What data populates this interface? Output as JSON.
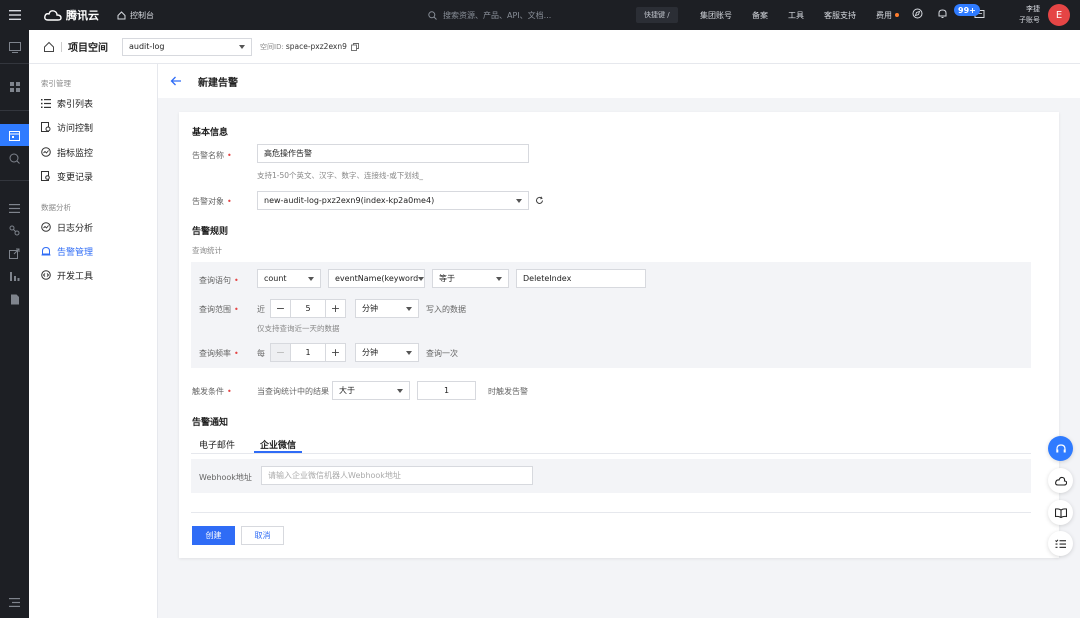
{
  "topbar": {
    "brand": "腾讯云",
    "console": "控制台",
    "search_placeholder": "搜索资源、产品、API、文档...",
    "shortcut": "快捷键 /",
    "links": [
      "集团账号",
      "备案",
      "工具",
      "客服支持",
      "费用"
    ],
    "badge": "99+",
    "user_name": "李捷",
    "user_role": "子账号",
    "avatar": "E",
    "accent": "#2f7bff"
  },
  "subheader": {
    "title": "项目空间",
    "project_select": "audit-log",
    "space_label": "空间ID:",
    "space_id": "space-pxz2exn9"
  },
  "leftnav": {
    "group1": "索引管理",
    "items1": [
      "索引列表",
      "访问控制",
      "指标监控",
      "变更记录"
    ],
    "group2": "数据分析",
    "items2": [
      "日志分析",
      "告警管理",
      "开发工具"
    ],
    "active": "告警管理"
  },
  "page": {
    "title": "新建告警"
  },
  "form": {
    "basic_title": "基本信息",
    "name_label": "告警名称",
    "name_value": "高危操作告警",
    "name_hint": "支持1-50个英文、汉字、数字、连接线-或下划线_",
    "target_label": "告警对象",
    "target_value": "new-audit-log-pxz2exn9(index-kp2a0me4)",
    "rule_title": "告警规则",
    "rule_sub": "查询统计",
    "query_label": "查询语句",
    "query_agg": "count",
    "query_field": "eventName(keyword",
    "query_op": "等于",
    "query_value": "DeleteIndex",
    "range_label": "查询范围",
    "range_prefix": "近",
    "range_value": "5",
    "range_unit": "分钟",
    "range_suffix": "写入的数据",
    "range_hint": "仅支持查询近一天的数据",
    "freq_label": "查询频率",
    "freq_prefix": "每",
    "freq_value": "1",
    "freq_unit": "分钟",
    "freq_suffix": "查询一次",
    "trigger_label": "触发条件",
    "trigger_prefix": "当查询统计中的结果",
    "trigger_op": "大于",
    "trigger_value": "1",
    "trigger_suffix": "时触发告警",
    "notify_title": "告警通知",
    "tabs": [
      "电子邮件",
      "企业微信"
    ],
    "active_tab": "企业微信",
    "webhook_label": "Webhook地址",
    "webhook_placeholder": "请输入企业微信机器人Webhook地址",
    "minus": "−",
    "plus": "+",
    "required_mark": "•",
    "create": "创建",
    "cancel": "取消"
  }
}
